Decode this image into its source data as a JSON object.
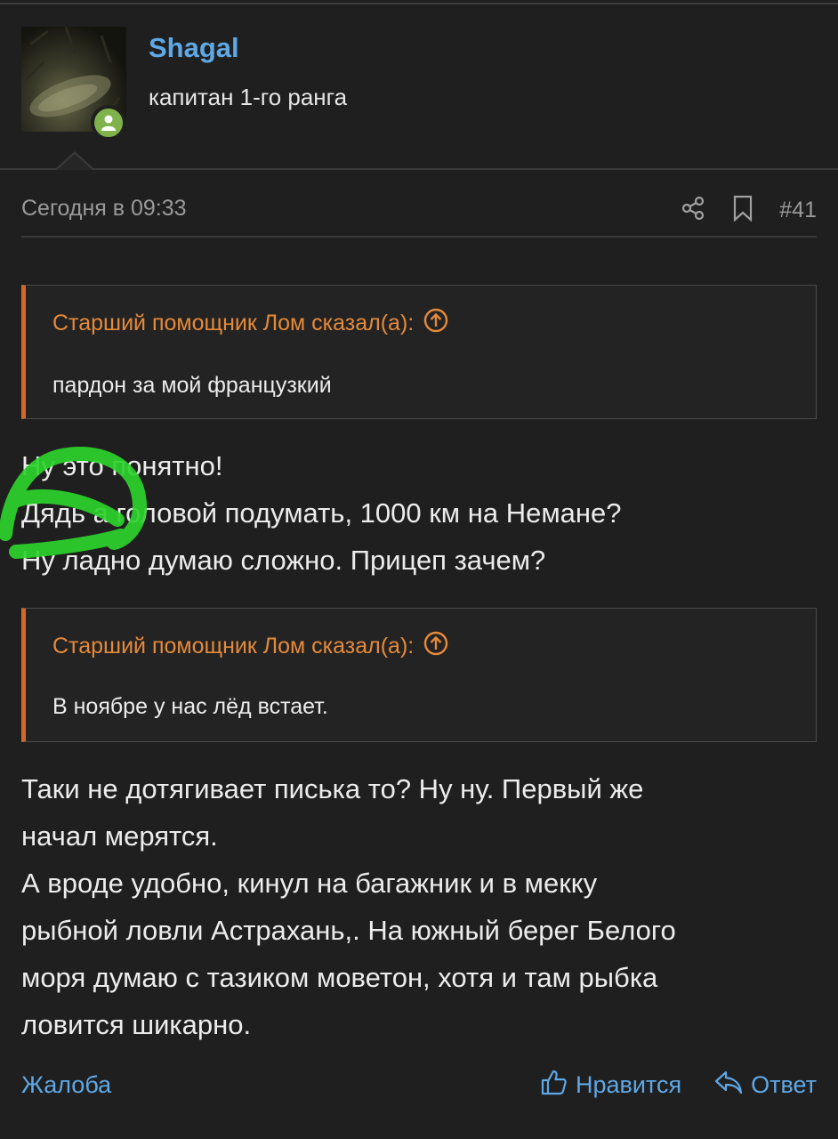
{
  "author": {
    "name": "Shagal",
    "rank": "капитан 1-го ранга"
  },
  "post": {
    "timestamp": "Сегодня в 09:33",
    "number": "#41"
  },
  "quotes": [
    {
      "author": "Старший помощник Лом сказал(а):",
      "text": "пардон за мой французкий"
    },
    {
      "author": "Старший помощник Лом сказал(а):",
      "text": "В ноябре у нас лёд встает."
    }
  ],
  "paragraph1": [
    "Ну это понятно!",
    "Дядь а головой подумать, 1000 км на Немане?",
    "Ну ладно думаю сложно. Прицеп зачем?"
  ],
  "paragraph2": [
    "Таки не дотягивает писька то? Ну ну. Первый же",
    "начал мерятся.",
    "А вроде удобно, кинул на багажник и в мекку",
    "рыбной ловли Астрахань,. На южный берег Белого",
    "моря думаю с тазиком моветон, хотя и там рыбка",
    "ловится шикарно."
  ],
  "footer": {
    "report": "Жалоба",
    "like": "Нравится",
    "reply": "Ответ"
  },
  "colors": {
    "link": "#5ea8e6",
    "quote_accent": "#d4692a",
    "quote_author": "#e58a3a",
    "online": "#7fb24a",
    "highlight": "#2cd22c"
  },
  "icons": {
    "share": "share-icon",
    "bookmark": "bookmark-icon",
    "expand_quote": "arrow-up-circle-icon",
    "like": "thumbs-up-icon",
    "reply": "reply-arrow-icon",
    "online": "user-icon"
  }
}
